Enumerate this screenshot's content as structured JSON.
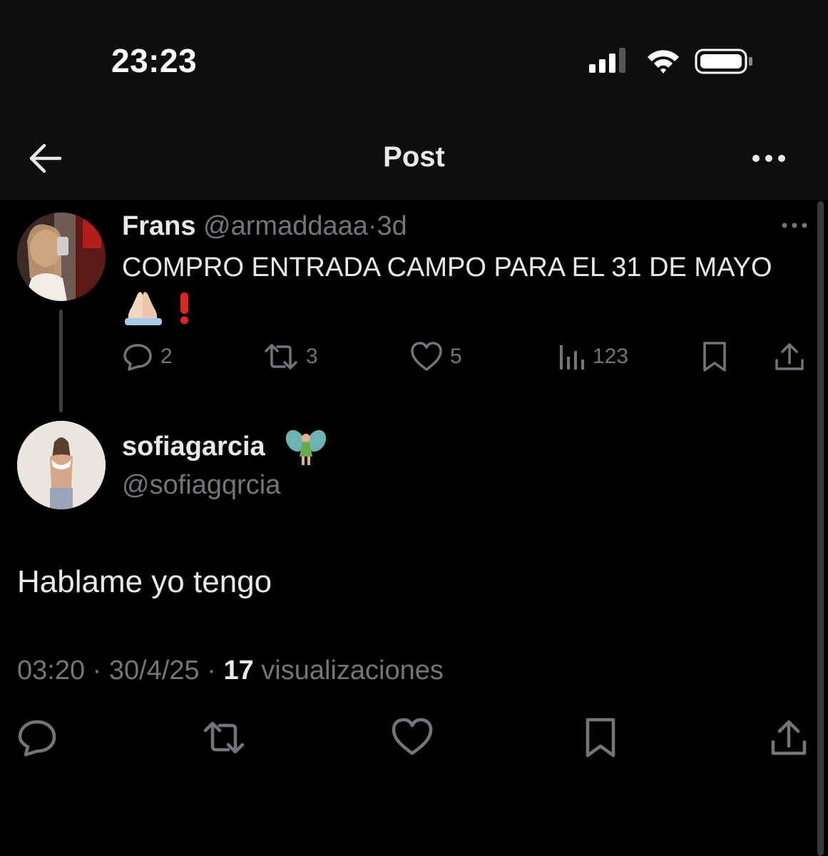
{
  "status_bar": {
    "time": "23:23",
    "icons": [
      "cellular-signal-icon",
      "wifi-icon",
      "battery-icon"
    ]
  },
  "nav": {
    "title": "Post",
    "back_icon": "arrow-left-icon",
    "more_icon": "more-horizontal-icon"
  },
  "parent_tweet": {
    "name": "Frans",
    "handle": "@armaddaaa",
    "separator": "·",
    "age": "3d",
    "text": "COMPRO ENTRADA CAMPO PARA EL 31 DE MAYO",
    "emoji_line": "🙏🏻❗",
    "actions": {
      "replies": "2",
      "reposts": "3",
      "likes": "5",
      "views": "123"
    }
  },
  "reply": {
    "name": "sofiagarcia",
    "name_emoji": "🧚",
    "handle": "@sofiagqrcia",
    "text": "Hablame yo tengo",
    "time": "03:20",
    "date": "30/4/25",
    "separator": "·",
    "views_count": "17",
    "views_label": "visualizaciones"
  },
  "colors": {
    "background": "#000000",
    "header_background": "#0e0e0e",
    "primary_text": "#e7e9ea",
    "secondary_text": "#71767b",
    "thread_line": "#3a3d41"
  }
}
